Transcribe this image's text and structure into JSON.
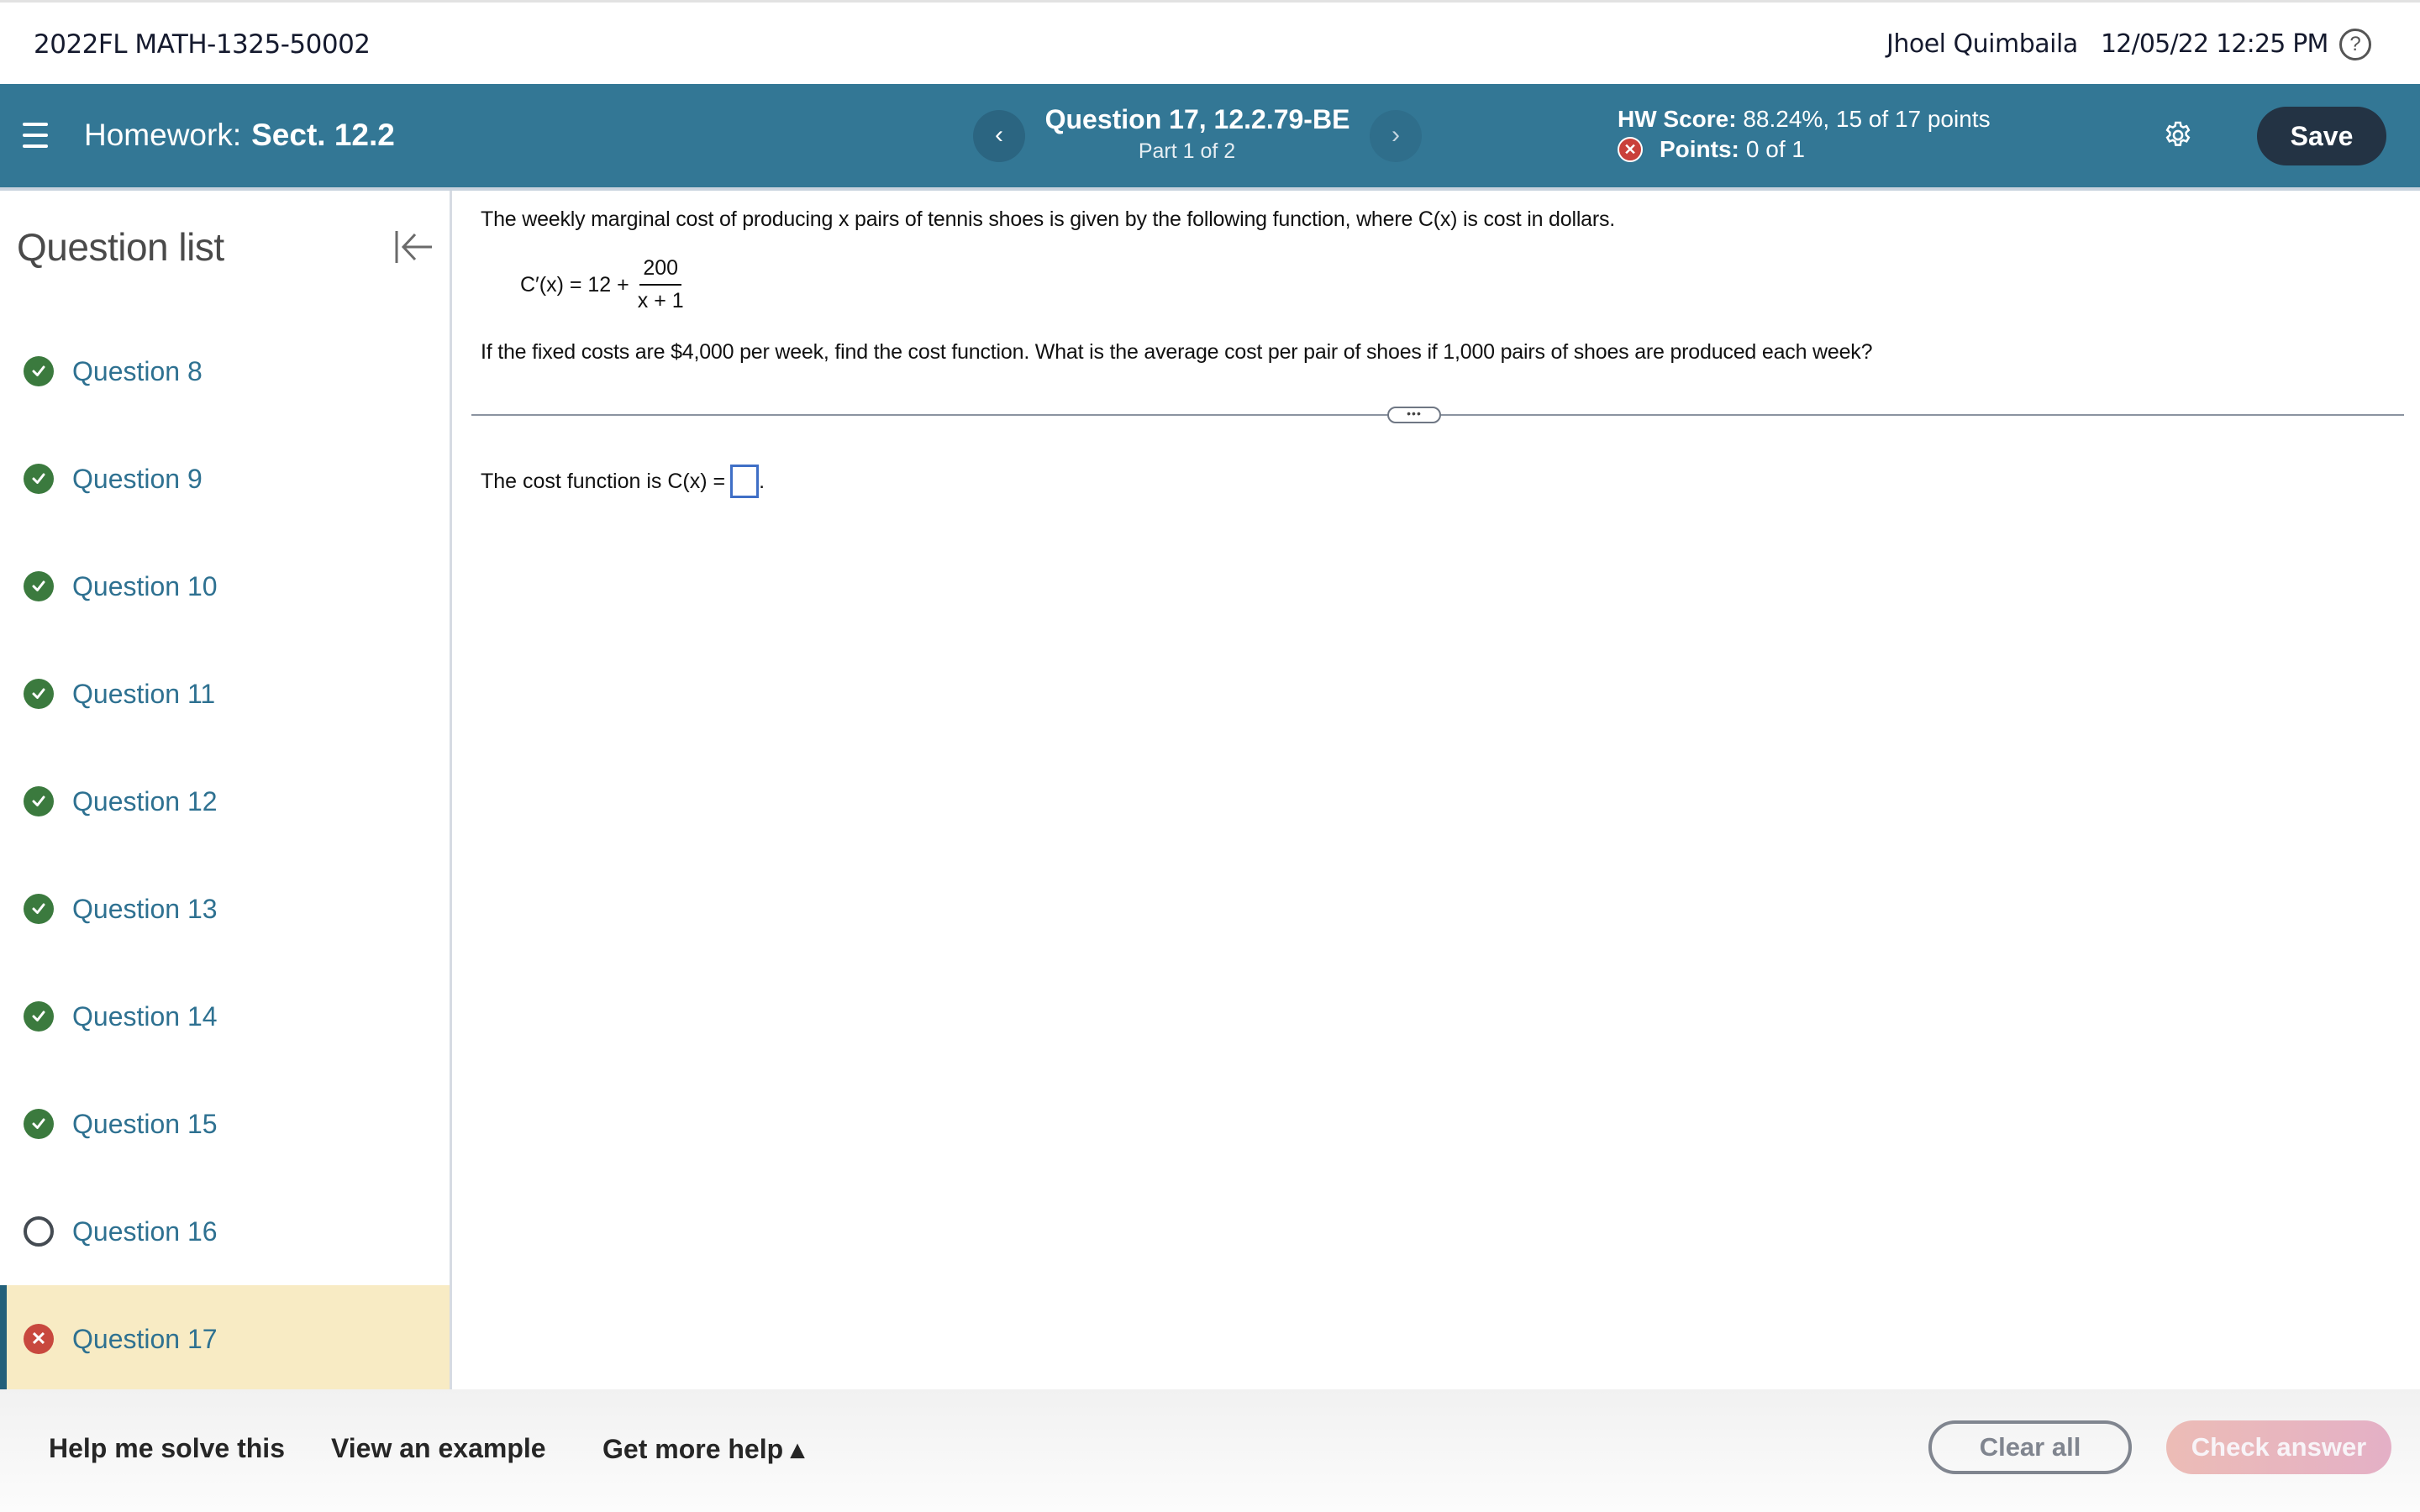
{
  "topbar": {
    "course": "2022FL MATH-1325-50002",
    "user": "Jhoel Quimbaila",
    "datetime": "12/05/22 12:25 PM",
    "help_icon": "?"
  },
  "header": {
    "homework_prefix": "Homework:",
    "homework_name": "Sect. 12.2",
    "question_title": "Question 17, 12.2.79-BE",
    "question_part": "Part 1 of 2",
    "prev_icon": "‹",
    "next_icon": "›",
    "hw_score_label": "HW Score:",
    "hw_score_value": "88.24%, 15 of 17 points",
    "points_label": "Points:",
    "points_value": "0 of 1",
    "save_label": "Save"
  },
  "sidebar": {
    "title": "Question list",
    "items": [
      {
        "label": "Question 8",
        "status": "correct"
      },
      {
        "label": "Question 9",
        "status": "correct"
      },
      {
        "label": "Question 10",
        "status": "correct"
      },
      {
        "label": "Question 11",
        "status": "correct"
      },
      {
        "label": "Question 12",
        "status": "correct"
      },
      {
        "label": "Question 13",
        "status": "correct"
      },
      {
        "label": "Question 14",
        "status": "correct"
      },
      {
        "label": "Question 15",
        "status": "correct"
      },
      {
        "label": "Question 16",
        "status": "unanswered"
      },
      {
        "label": "Question 17",
        "status": "incorrect",
        "active": true
      }
    ]
  },
  "question": {
    "intro": "The weekly marginal cost of producing x pairs of tennis shoes is given by the following function, where C(x) is cost in dollars.",
    "formula_lhs": "C′(x) = 12 +",
    "formula_numerator": "200",
    "formula_denominator": "x + 1",
    "prompt": "If the fixed costs are $4,000 per week, find the cost function.  What is the average cost per pair of shoes if 1,000 pairs of shoes are produced each week?",
    "expand_label": "•••",
    "answer_prefix": "The cost function is C(x) =",
    "answer_value": "",
    "answer_suffix": "."
  },
  "footer": {
    "help_me_solve": "Help me solve this",
    "view_example": "View an example",
    "get_more_help": "Get more help ▴",
    "clear_all": "Clear all",
    "check_answer": "Check answer"
  },
  "colors": {
    "header_bg": "#337795",
    "correct": "#3b7a3e",
    "incorrect": "#c8483e",
    "active_row": "#f8ebc4",
    "link": "#2e7191",
    "save_bg": "#233344"
  }
}
